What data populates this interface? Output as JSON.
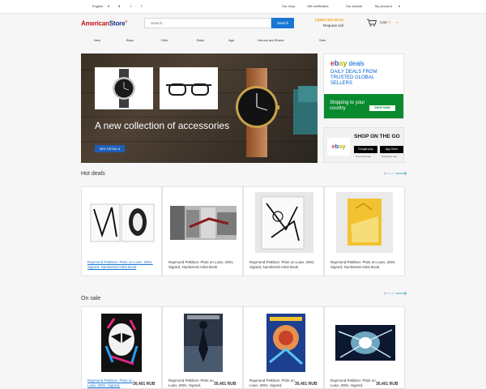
{
  "topbar": {
    "language": "English",
    "language_arrow": "▾",
    "currency": "$",
    "social_twitter": "t",
    "social_facebook": "f",
    "links": [
      "Our shop",
      "Gift certificates",
      "Our brands",
      "My Account"
    ],
    "account_arrow": "▾"
  },
  "header": {
    "logo_part1": "American",
    "logo_part2": "Store",
    "logo_mark": "®",
    "search_placeholder": "Search...",
    "search_button": "Search",
    "phone": "(3)800-000-00-00",
    "request_call": "Request call",
    "cart_label": "Cart:",
    "cart_count": "0",
    "cart_arrow": "▾"
  },
  "nav": {
    "items": [
      "New",
      "Boys",
      "Girls",
      "Baby",
      "Age",
      "Heroes and Brand",
      "Sale"
    ]
  },
  "hero": {
    "title": "A new collection of accessories",
    "button": "SEE DETAILS",
    "slides": 3,
    "active_slide": 1
  },
  "ebay_deals": {
    "logo": [
      "e",
      "b",
      "a",
      "y"
    ],
    "deals_word": "deals",
    "tagline": "DAILY DEALS FROM TRUSTED GLOBAL SELLERS",
    "shipping_text": "Shipping to your country",
    "shop_button": "SHOP NOW"
  },
  "ebay_app": {
    "logo": [
      "e",
      "b",
      "a",
      "y"
    ],
    "headline": "SHOP ON THE GO",
    "google_badge": "Google play",
    "apple_badge": "App Store",
    "download_label": "Download app"
  },
  "hot_deals": {
    "title": "Hot deals",
    "prev_arrow": "⟵",
    "next_arrow": "⟶",
    "products": [
      {
        "name": "Raymond Pettibon: Plots on Loan, 2001. Signed, Numbered Artist Book",
        "link": true
      },
      {
        "name": "Raymond Pettibon: Plots on Loan, 2001. Signed, Numbered Artist Book",
        "link": false
      },
      {
        "name": "Raymond Pettibon: Plots on Loan, 2001. Signed, Numbered Artist Book",
        "link": false
      },
      {
        "name": "Raymond Pettibon: Plots on Loan, 2001. Signed, Numbered Artist Book",
        "link": false
      }
    ]
  },
  "on_sale": {
    "title": "On sale",
    "prev_arrow": "⟵",
    "next_arrow": "⟶",
    "products": [
      {
        "name": "Raymond Pettibon: Plots on Loan, 2001. Signed,",
        "price": "30,401 RUB",
        "link": true
      },
      {
        "name": "Raymond Pettibon: Plots on Loan, 2001. Signed,",
        "price": "30,401 RUB",
        "link": false
      },
      {
        "name": "Raymond Pettibon: Plots on Loan, 2001. Signed,",
        "price": "30,401 RUB",
        "link": false
      },
      {
        "name": "Raymond Pettibon: Plots on Loan, 2001. Signed,",
        "price": "30,401 RUB",
        "link": false
      }
    ]
  },
  "colors": {
    "brand_red": "#c4161c",
    "brand_blue": "#1d2f8a",
    "accent_orange": "#f5a623",
    "button_blue": "#1976d2",
    "arrow_teal": "#45aeb5"
  }
}
